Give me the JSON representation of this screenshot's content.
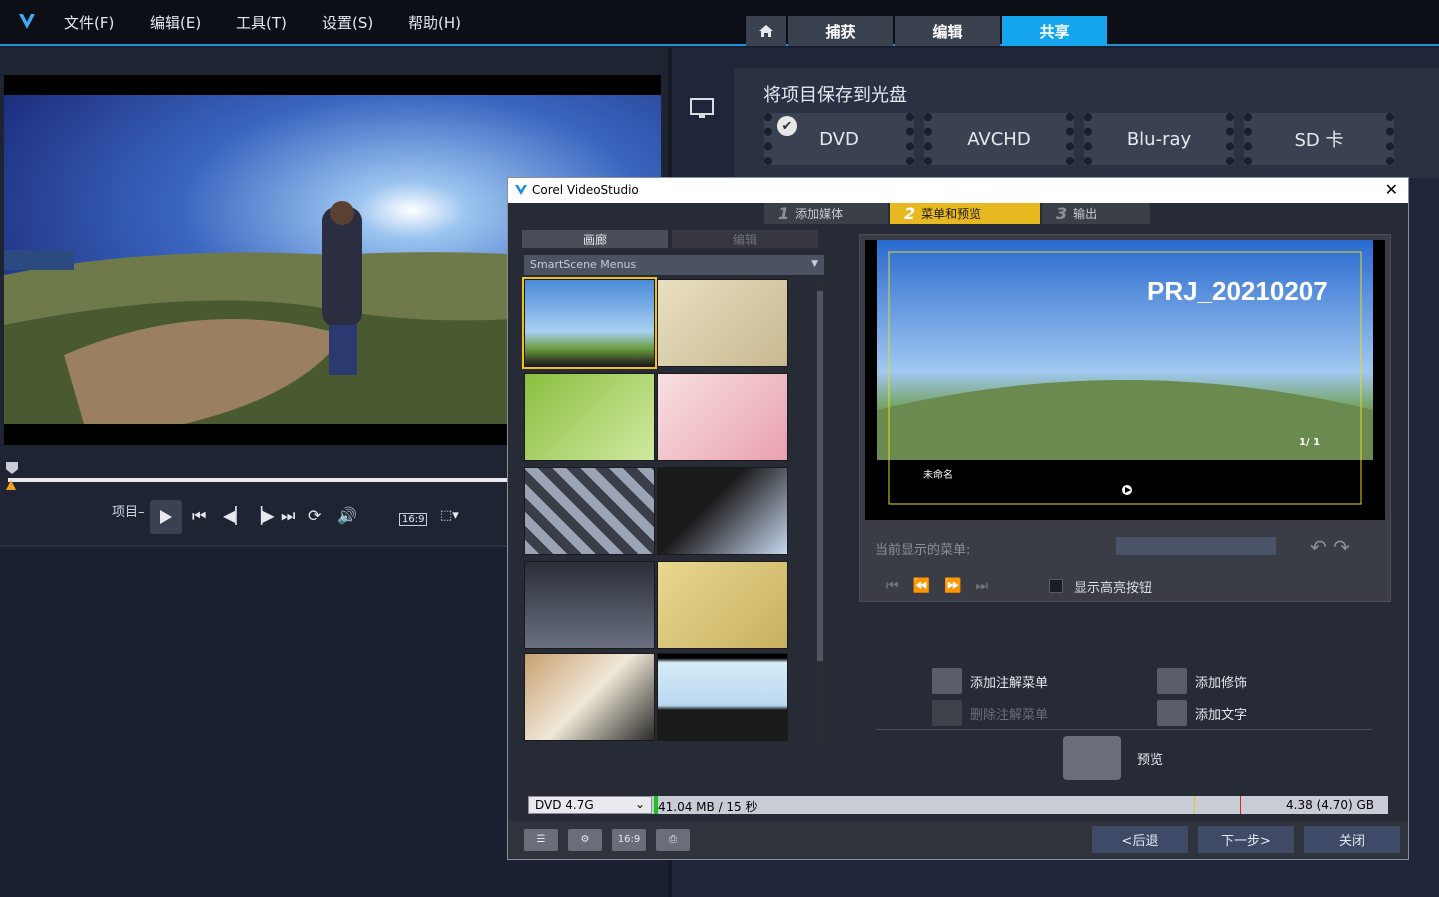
{
  "menubar": {
    "items": [
      "文件(F)",
      "编辑(E)",
      "工具(T)",
      "设置(S)",
      "帮助(H)"
    ],
    "mode_tabs": [
      "捕获",
      "编辑",
      "共享"
    ],
    "active_tab": "共享"
  },
  "player": {
    "project_label": "项目–",
    "aspect": "16:9"
  },
  "share": {
    "title": "将项目保存到光盘",
    "disc_buttons": [
      "DVD",
      "AVCHD",
      "Blu-ray",
      "SD 卡"
    ],
    "selected_disc": "DVD"
  },
  "dialog": {
    "title": "Corel VideoStudio",
    "steps": [
      {
        "num": "1",
        "label": "添加媒体"
      },
      {
        "num": "2",
        "label": "菜单和预览"
      },
      {
        "num": "3",
        "label": "输出"
      }
    ],
    "active_step": "2",
    "gallery_tabs": [
      "画廊",
      "编辑"
    ],
    "menu_category": "SmartScene Menus",
    "preview": {
      "title": "PRJ_20210207",
      "clip_label": "未命名",
      "page": "1/ 1"
    },
    "current_menu_label": "当前显示的菜单:",
    "show_highlight_label": "显示高亮按钮",
    "actions": {
      "add_annotation_menu": "添加注解菜单",
      "delete_annotation_menu": "删除注解菜单",
      "add_decoration": "添加修饰",
      "add_text": "添加文字",
      "preview": "预览"
    },
    "capacity": {
      "disc_type": "DVD 4.7G",
      "used": "41.04 MB / 15 秒",
      "total": "4.38 (4.70) GB"
    },
    "footer_buttons": {
      "back": "<后退",
      "next": "下一步>",
      "close": "关闭"
    },
    "footer_icons": [
      "chapter-icon",
      "settings-icon",
      "aspect-icon",
      "print-icon"
    ],
    "footer_aspect": "16:9"
  },
  "colors": {
    "accent": "#16a6f0",
    "step_active": "#e8b820",
    "thumb_selected": "#f0c020"
  }
}
